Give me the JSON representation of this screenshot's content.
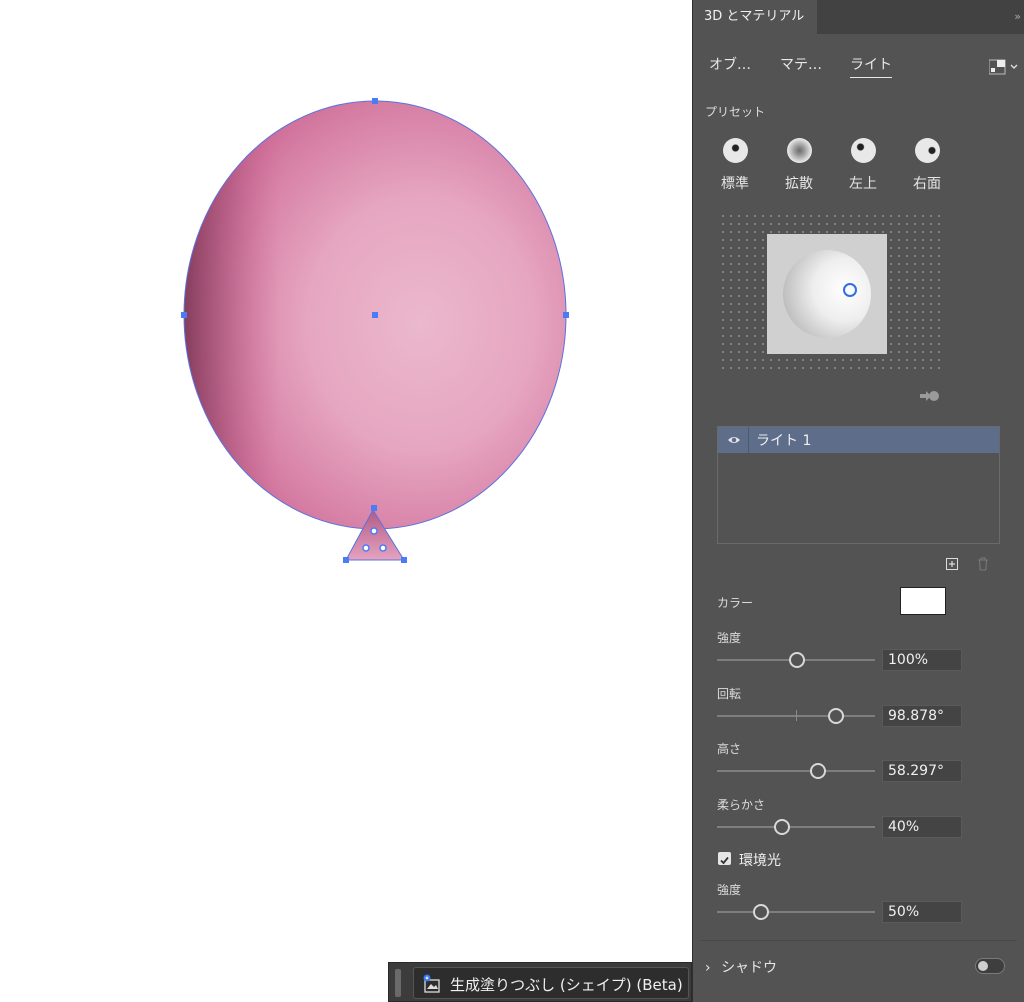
{
  "panel": {
    "title": "3D とマテリアル",
    "collapse": "»",
    "tabs": [
      "オブ…",
      "マテ…",
      "ライト"
    ],
    "active_tab": "ライト",
    "presets_label": "プリセット",
    "presets": [
      "標準",
      "拡散",
      "左上",
      "右面"
    ],
    "lights": [
      {
        "name": "ライト 1",
        "visible": true,
        "selected": true
      }
    ],
    "color_label": "カラー",
    "color_value": "#ffffff",
    "intensity_label": "強度",
    "intensity_value": "100%",
    "rotation_label": "回転",
    "rotation_value": "98.878°",
    "height_label": "高さ",
    "height_value": "58.297°",
    "softness_label": "柔らかさ",
    "softness_value": "40%",
    "ambient_label": "環境光",
    "ambient_checked": true,
    "ambient_intensity_label": "強度",
    "ambient_intensity_value": "50%",
    "shadow_label": "シャドウ",
    "shadow_enabled": false
  },
  "context_bar": {
    "button_label": "生成塗りつぶし (シェイプ) (Beta)"
  },
  "colors": {
    "panel_bg": "#535353",
    "selection": "#4a7cf7",
    "balloon": "#e8a9c4",
    "light_row_selected": "#5d6d8a"
  }
}
